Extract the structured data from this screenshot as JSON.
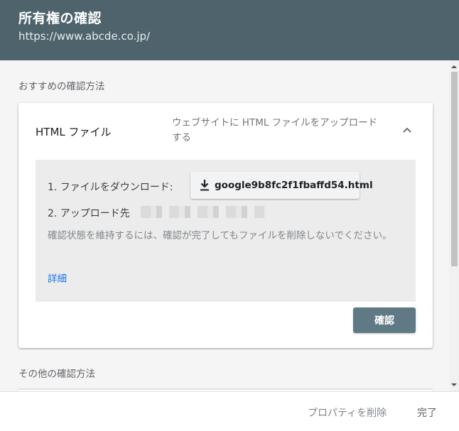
{
  "header": {
    "title": "所有権の確認",
    "url": "https://www.abcde.co.jp/"
  },
  "recommended": {
    "section_label": "おすすめの確認方法",
    "method_title": "HTML ファイル",
    "method_description": "ウェブサイトに HTML ファイルをアップロードする",
    "chevron_icon": "chevron-up-icon",
    "steps": {
      "step1_label": "1. ファイルをダウンロード:",
      "download_filename": "google9b8fc2f1fbaffd54.html",
      "download_icon": "download-icon",
      "step2_label": "2. アップロード先"
    },
    "note": "確認状態を維持するには、確認が完了してもファイルを削除しないでください。",
    "detail_link": "詳細",
    "confirm_button": "確認"
  },
  "other": {
    "section_label": "その他の確認方法"
  },
  "footer": {
    "delete_property": "プロパティを削除",
    "done": "完了"
  },
  "colors": {
    "header_bg": "#4e636c",
    "confirm_button_bg": "#5f7a85",
    "link": "#1a73e8"
  }
}
